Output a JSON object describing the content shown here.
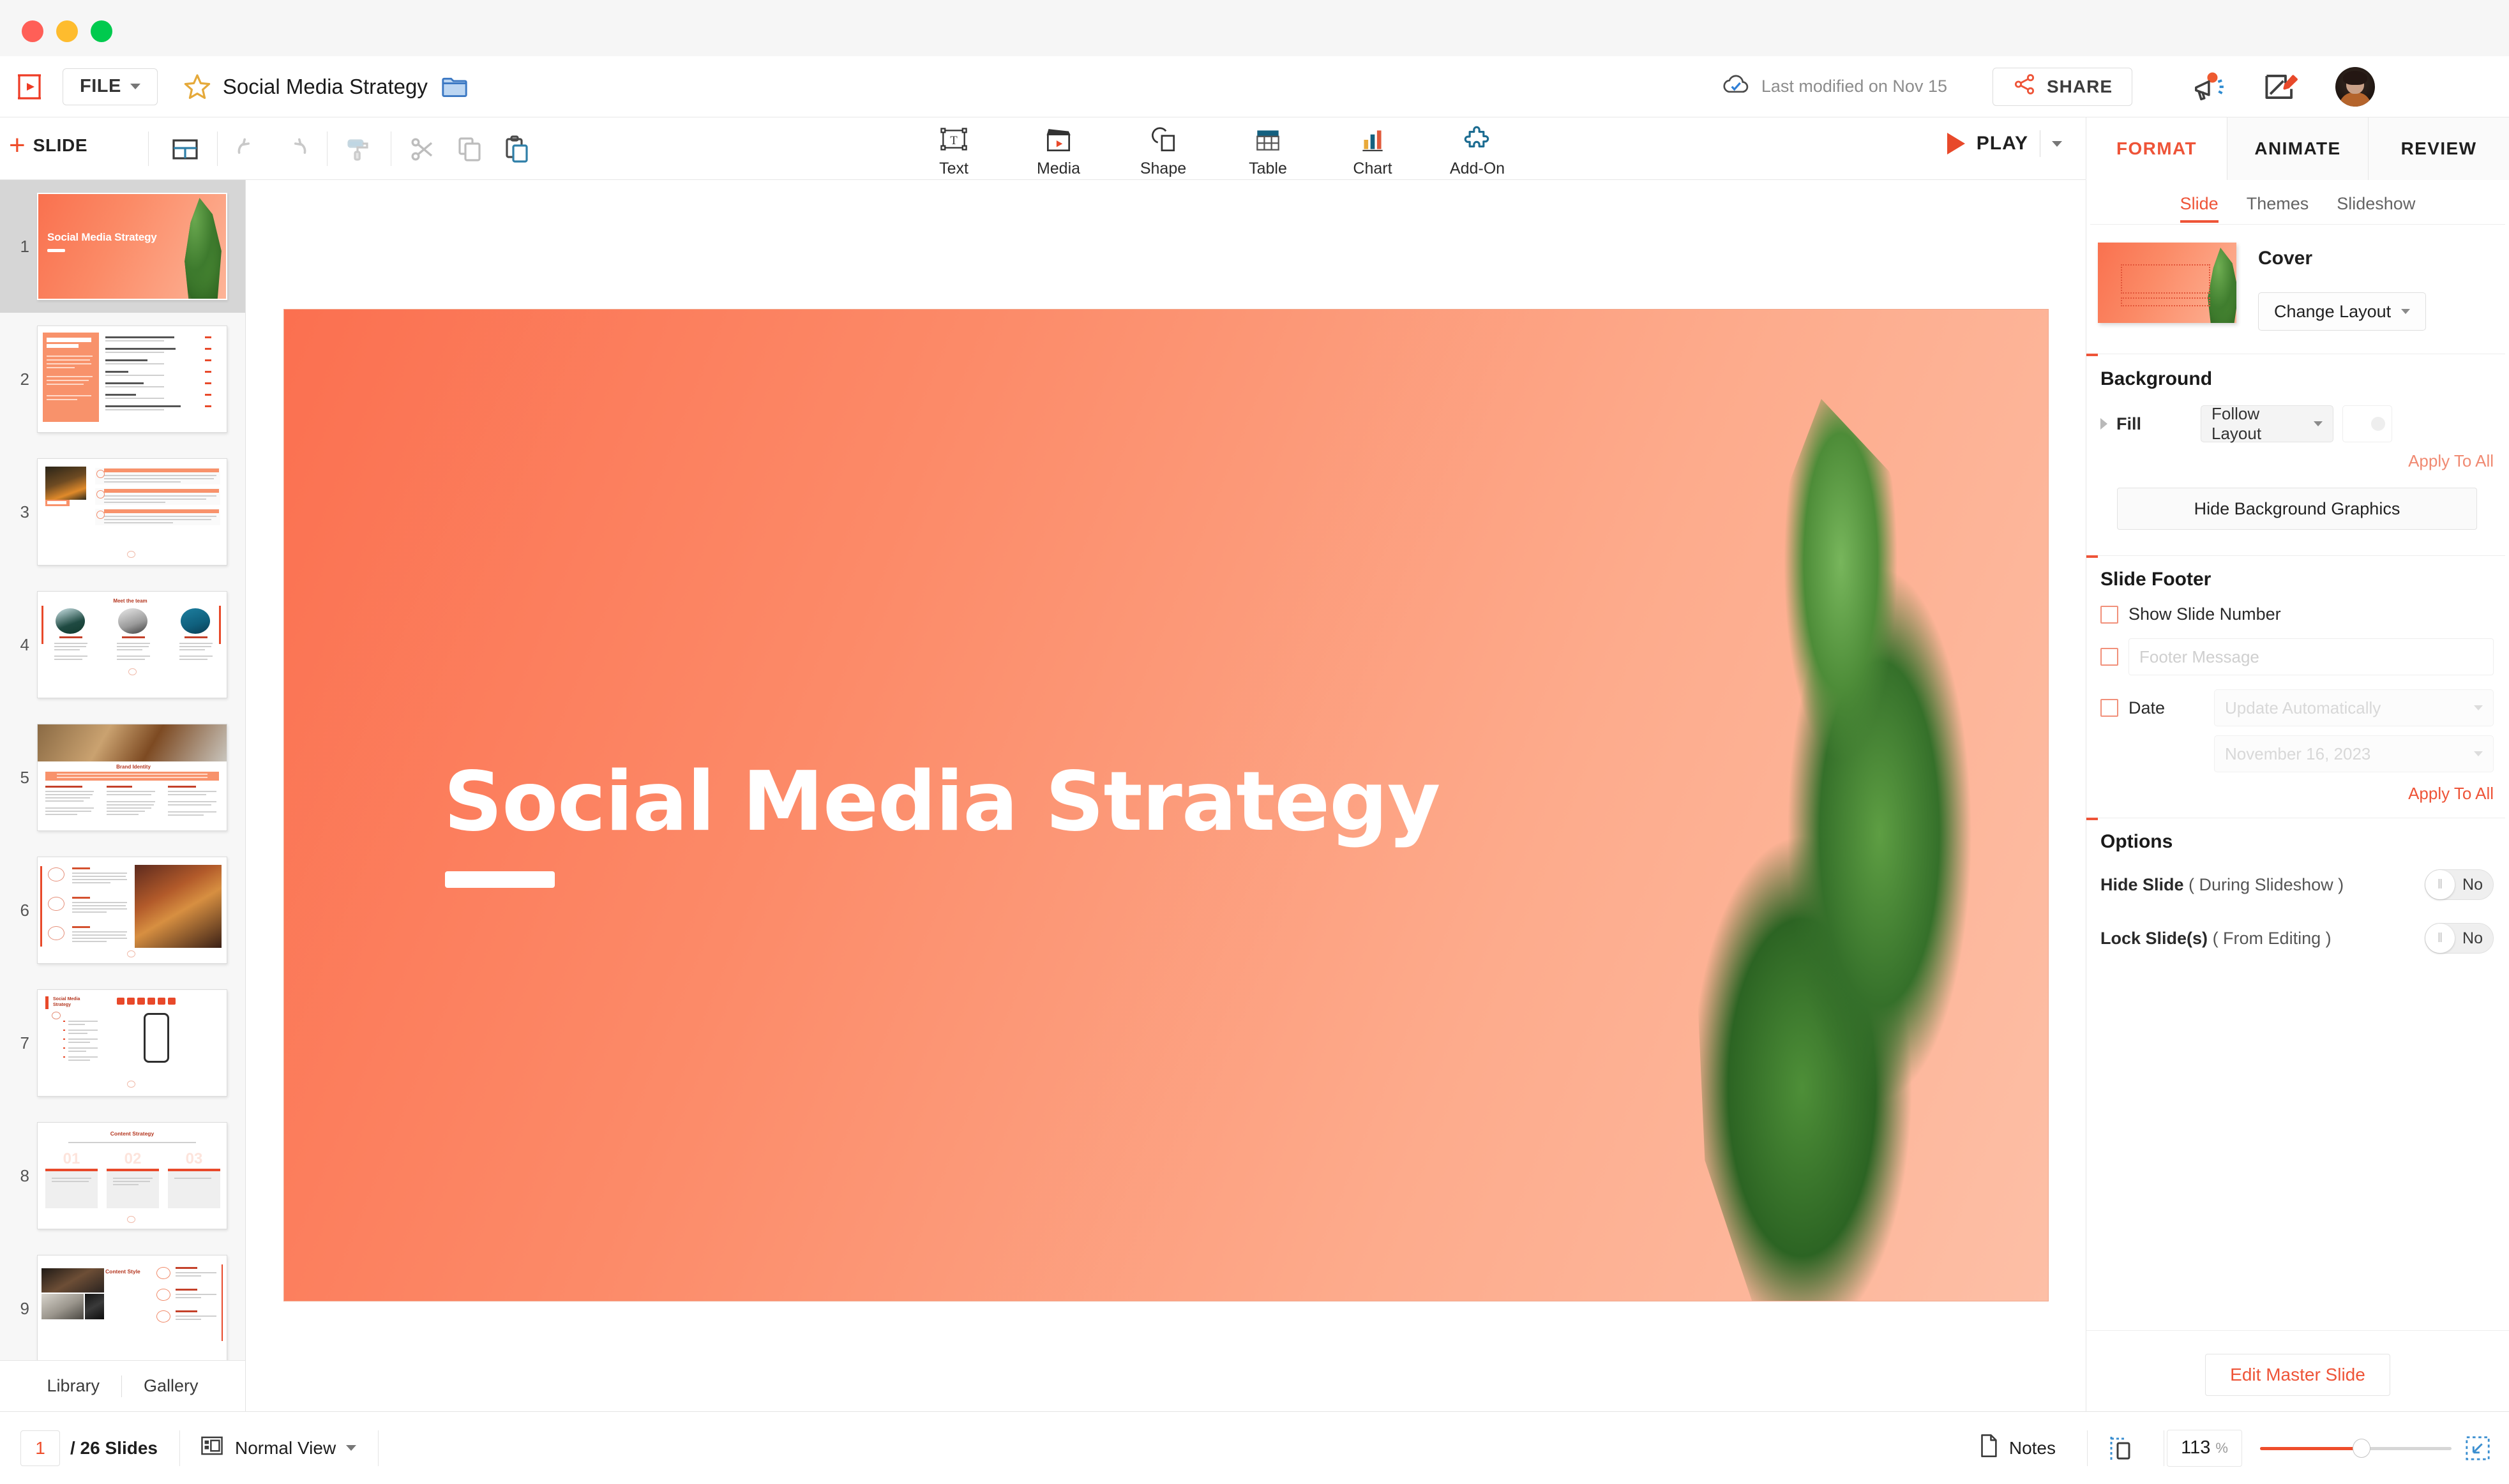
{
  "window": {
    "traffic_lights": [
      "close",
      "minimize",
      "maximize"
    ]
  },
  "docbar": {
    "logo_icon": "presentation-logo-icon",
    "file_menu_label": "FILE",
    "favorite_icon": "star-icon",
    "document_title": "Social Media Strategy",
    "folder_icon": "folder-icon",
    "cloud_icon": "cloud-saved-icon",
    "last_modified": "Last modified on Nov 15",
    "share_label": "SHARE",
    "share_icon": "share-nodes-icon",
    "announcement_icon": "megaphone-icon",
    "feedback_icon": "feedback-pencil-icon",
    "avatar": "user-avatar"
  },
  "toolbar": {
    "add_slide_label": "SLIDE",
    "add_slide_plus": "+",
    "layout_icon": "slide-layout-icon",
    "undo_icon": "undo-icon",
    "redo_icon": "redo-icon",
    "format_painter_icon": "paint-roller-icon",
    "cut_icon": "scissors-icon",
    "copy_icon": "copy-icon",
    "paste_icon": "paste-icon",
    "insert_items": [
      {
        "label": "Text",
        "icon": "text-box-icon"
      },
      {
        "label": "Media",
        "icon": "media-clapperboard-icon"
      },
      {
        "label": "Shape",
        "icon": "shape-icon"
      },
      {
        "label": "Table",
        "icon": "table-icon"
      },
      {
        "label": "Chart",
        "icon": "bar-chart-icon"
      },
      {
        "label": "Add-On",
        "icon": "puzzle-piece-icon"
      }
    ],
    "play_label": "PLAY",
    "play_icon": "play-triangle-icon",
    "play_dropdown_icon": "chevron-down-icon"
  },
  "right_panel": {
    "tabs": [
      {
        "label": "FORMAT",
        "active": true
      },
      {
        "label": "ANIMATE",
        "active": false
      },
      {
        "label": "REVIEW",
        "active": false
      }
    ],
    "subtabs": [
      {
        "label": "Slide",
        "active": true
      },
      {
        "label": "Themes",
        "active": false
      },
      {
        "label": "Slideshow",
        "active": false
      }
    ],
    "layout": {
      "name": "Cover",
      "change_layout_label": "Change Layout",
      "thumbnail": "cover-layout-thumbnail"
    },
    "background": {
      "heading": "Background",
      "fill_label": "Fill",
      "fill_value": "Follow Layout",
      "color_swatch": "background-color-swatch",
      "apply_to_all": "Apply To All",
      "hide_bg_graphics": "Hide Background Graphics",
      "expand_icon": "triangle-right-icon"
    },
    "slide_footer": {
      "heading": "Slide Footer",
      "show_slide_number_label": "Show Slide Number",
      "show_slide_number_checked": false,
      "footer_message_placeholder": "Footer Message",
      "footer_message_value": "",
      "footer_message_checked": false,
      "date_label": "Date",
      "date_checked": false,
      "date_mode": "Update Automatically",
      "date_value": "November 16, 2023",
      "apply_to_all": "Apply To All"
    },
    "options": {
      "heading": "Options",
      "rows": [
        {
          "label": "Hide Slide",
          "note": "( During Slideshow )",
          "value": "No"
        },
        {
          "label": "Lock Slide(s)",
          "note": "( From Editing )",
          "value": "No"
        }
      ]
    },
    "edit_master_label": "Edit Master Slide"
  },
  "slide_panel": {
    "slides": [
      {
        "num": "1",
        "kind": "cover",
        "title": "Social Media Strategy",
        "selected": true
      },
      {
        "num": "2",
        "kind": "toc",
        "title": "Table of Contents",
        "selected": false
      },
      {
        "num": "3",
        "kind": "persona",
        "title": "Persona",
        "selected": false
      },
      {
        "num": "4",
        "kind": "team",
        "title": "Meet the team",
        "selected": false
      },
      {
        "num": "5",
        "kind": "brand",
        "title": "Brand Identity",
        "selected": false
      },
      {
        "num": "6",
        "kind": "values",
        "title": "Values",
        "selected": false
      },
      {
        "num": "7",
        "kind": "phone",
        "title": "Social Media Strategy",
        "selected": false
      },
      {
        "num": "8",
        "kind": "content",
        "title": "Content Strategy",
        "selected": false
      },
      {
        "num": "9",
        "kind": "style",
        "title": "Content Style",
        "selected": false
      }
    ],
    "library_label": "Library",
    "gallery_label": "Gallery"
  },
  "canvas": {
    "slide_title": "Social Media Strategy",
    "accent_color": "#ee4d2b",
    "background_gradient_from": "#fb7050",
    "background_gradient_to": "#fdbfa6"
  },
  "status_bar": {
    "current_slide": "1",
    "slide_count_label": "/ 26 Slides",
    "view_mode": "Normal View",
    "view_mode_icon": "normal-view-icon",
    "notes_label": "Notes",
    "notes_icon": "notes-page-icon",
    "guides_icon": "guides-icon",
    "zoom_value": "113",
    "zoom_unit": "%",
    "fit_icon": "fit-to-screen-icon"
  }
}
